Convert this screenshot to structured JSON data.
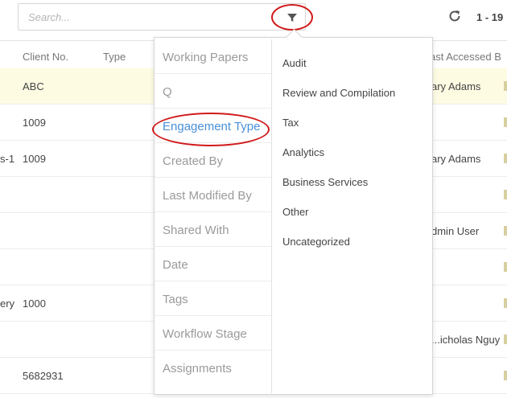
{
  "search": {
    "placeholder": "Search..."
  },
  "toolbar": {
    "pager_text": "1 - 19"
  },
  "table": {
    "headers": {
      "client_no": "Client No.",
      "type": "Type",
      "last_accessed": "ast Accessed B"
    },
    "rows": [
      {
        "col_a": "",
        "client_no": "ABC",
        "last_accessed": "ary Adams"
      },
      {
        "col_a": "",
        "client_no": "1009",
        "last_accessed": ""
      },
      {
        "col_a": "s-1",
        "client_no": "1009",
        "last_accessed": "ary Adams"
      },
      {
        "col_a": "",
        "client_no": "",
        "last_accessed": ""
      },
      {
        "col_a": "",
        "client_no": "",
        "last_accessed": "dmin User"
      },
      {
        "col_a": "",
        "client_no": "",
        "last_accessed": ""
      },
      {
        "col_a": "ery",
        "client_no": "1000",
        "last_accessed": ""
      },
      {
        "col_a": "",
        "client_no": "",
        "last_accessed": "icholas Nguy..."
      },
      {
        "col_a": "",
        "client_no": "5682931",
        "last_accessed": ""
      }
    ]
  },
  "filter_menu": {
    "categories": [
      "Working Papers",
      "Q",
      "Engagement Type",
      "Created By",
      "Last Modified By",
      "Shared With",
      "Date",
      "Tags",
      "Workflow Stage",
      "Assignments"
    ],
    "active_category": "Engagement Type",
    "options": [
      "Audit",
      "Review and Compilation",
      "Tax",
      "Analytics",
      "Business Services",
      "Other",
      "Uncategorized"
    ]
  },
  "colors": {
    "accent": "#4a90d9",
    "annotation": "#d11a1a",
    "highlight_row": "#fdfbe2"
  }
}
